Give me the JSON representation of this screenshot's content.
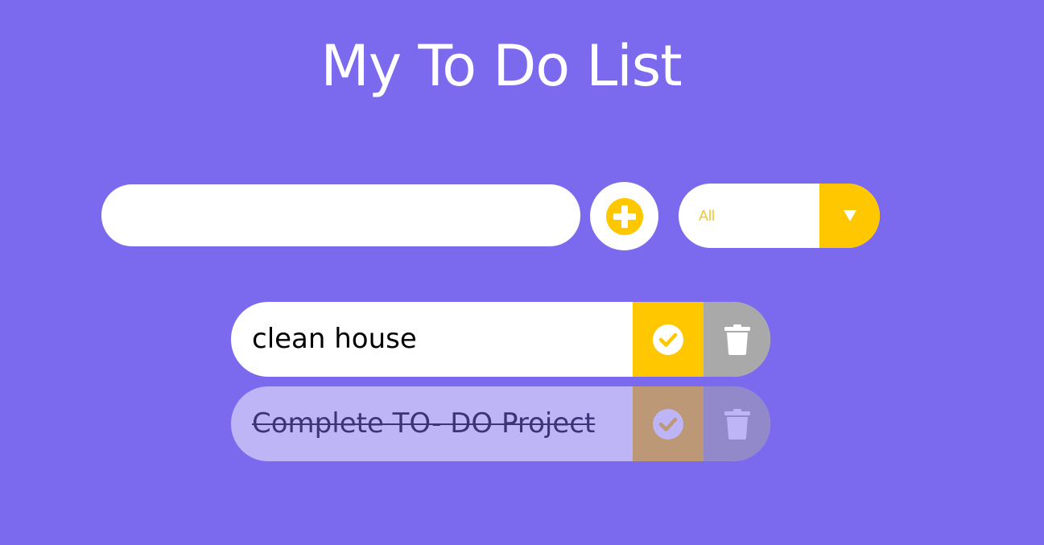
{
  "header": {
    "title": "My To Do List"
  },
  "form": {
    "input_value": "",
    "input_placeholder": "",
    "add_icon": "plus-circle-icon",
    "filter": {
      "selected": "All",
      "arrow_glyph": "▼"
    }
  },
  "todos": [
    {
      "text": "clean house",
      "completed": false
    },
    {
      "text": "Complete TO- DO Project",
      "completed": true
    }
  ],
  "colors": {
    "background": "#7b6aee",
    "accent": "#ffc700",
    "trash": "#a9a9a9",
    "filter_text": "#f8c52b"
  }
}
